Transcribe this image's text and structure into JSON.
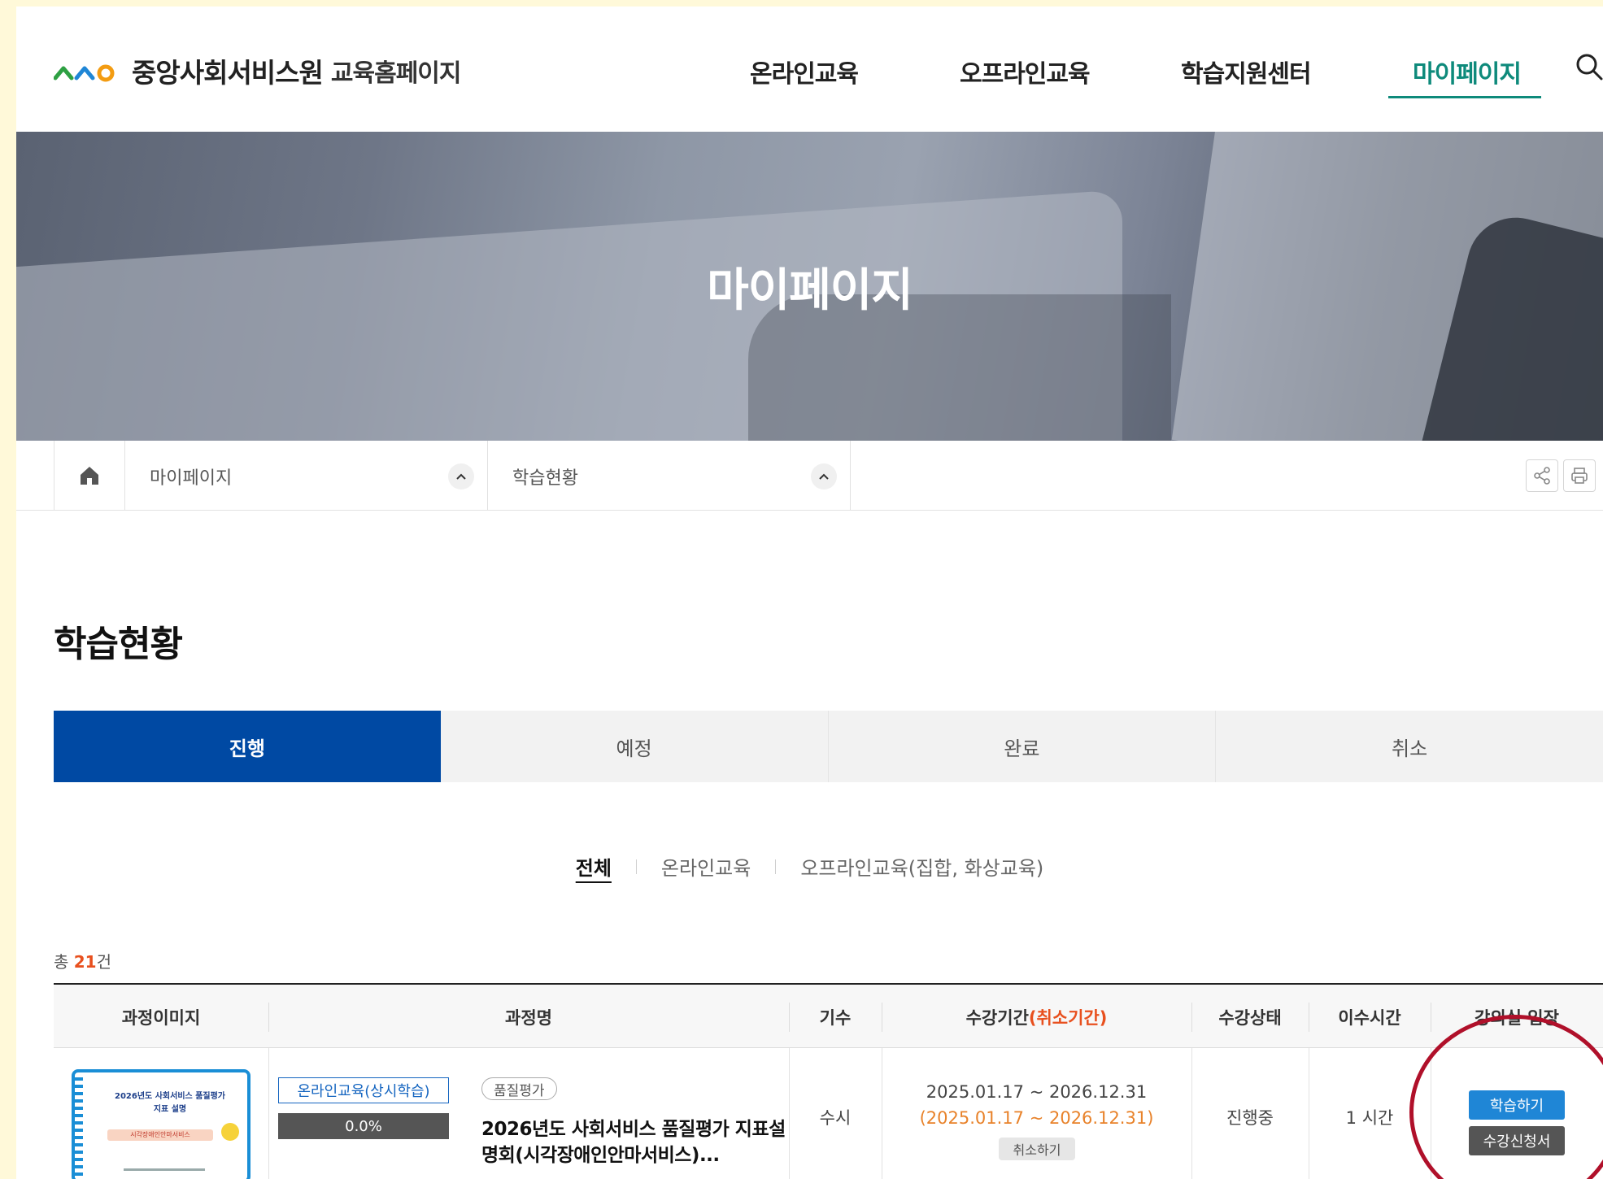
{
  "site": {
    "logo_text": "중앙사회서비스원",
    "logo_sub": "교육홈페이지"
  },
  "nav": {
    "items": [
      {
        "label": "온라인교육"
      },
      {
        "label": "오프라인교육"
      },
      {
        "label": "학습지원센터"
      },
      {
        "label": "마이페이지"
      }
    ],
    "active": "마이페이지"
  },
  "hero": {
    "title": "마이페이지"
  },
  "breadcrumb": {
    "level1": "마이페이지",
    "level2": "학습현황"
  },
  "page": {
    "title": "학습현황"
  },
  "tabs": [
    {
      "label": "진행"
    },
    {
      "label": "예정"
    },
    {
      "label": "완료"
    },
    {
      "label": "취소"
    }
  ],
  "active_tab": "진행",
  "filters": [
    {
      "label": "전체"
    },
    {
      "label": "온라인교육"
    },
    {
      "label": "오프라인교육(집합, 화상교육)"
    }
  ],
  "active_filter": "전체",
  "total": {
    "prefix": "총 ",
    "count": "21",
    "suffix": "건"
  },
  "table": {
    "headers": {
      "image": "과정이미지",
      "name": "과정명",
      "term": "기수",
      "period": "수강기간",
      "period_note": "(취소기간)",
      "status": "수강상태",
      "hours": "이수시간",
      "enter": "강의실 입장"
    },
    "rows": [
      {
        "thumb_title1": "2026년도 사회서비스 품질평가",
        "thumb_title2": "지표 설명",
        "thumb_tag": "시각장애인안마서비스",
        "type": "온라인교육(상시학습)",
        "progress_text": "0.0%",
        "progress": 0.0,
        "badge": "품질평가",
        "name": "2026년도 사회서비스 품질평가 지표설명회(시각장애인안마서비스)...",
        "term": "수시",
        "period": "2025.01.17 ~ 2026.12.31",
        "cancel_period": "(2025.01.17 ~ 2026.12.31)",
        "cancel_label": "취소하기",
        "status": "진행중",
        "hours": "1 시간",
        "study_label": "학습하기",
        "apply_label": "수강신청서"
      }
    ]
  },
  "colors": {
    "accent_teal": "#0e8a7b",
    "tab_active": "#0049a3",
    "highlight_orange": "#e8501e",
    "study_button": "#1f86d6",
    "annotation_circle": "#b0102a"
  }
}
